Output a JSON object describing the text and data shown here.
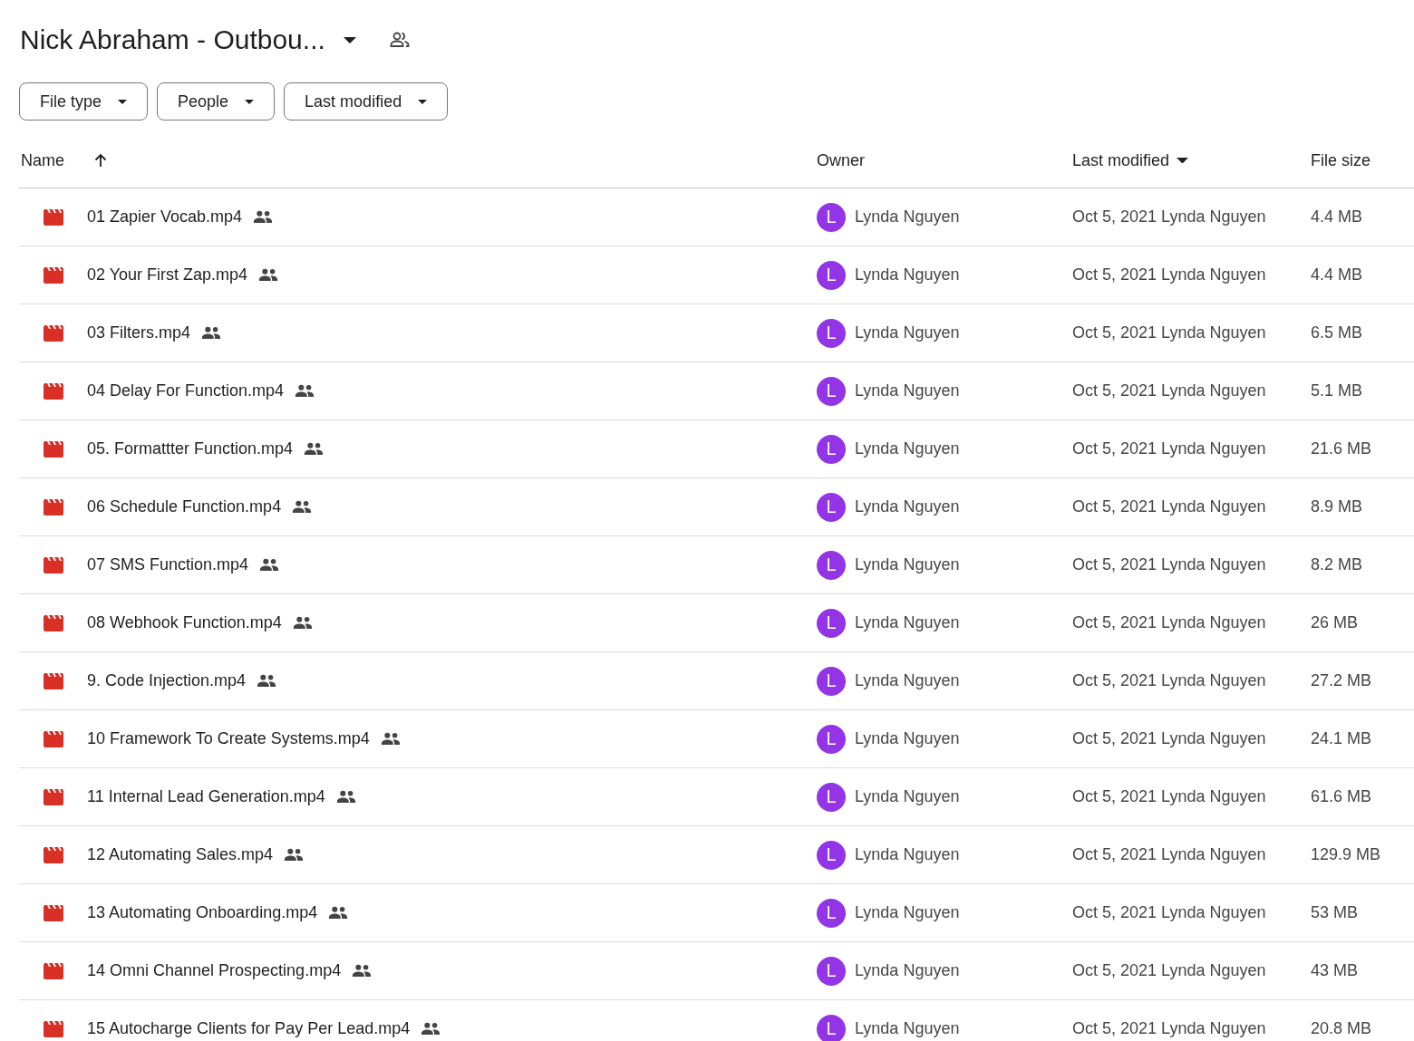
{
  "title": "Nick Abraham - Outbou...",
  "filters": [
    "File type",
    "People",
    "Last modified"
  ],
  "columns": {
    "name": "Name",
    "owner": "Owner",
    "modified": "Last modified",
    "size": "File size"
  },
  "rows": [
    {
      "name": "01 Zapier Vocab.mp4",
      "owner_initial": "L",
      "owner": "Lynda Nguyen",
      "modified": "Oct 5, 2021 Lynda Nguyen",
      "size": "4.4 MB"
    },
    {
      "name": "02 Your First Zap.mp4",
      "owner_initial": "L",
      "owner": "Lynda Nguyen",
      "modified": "Oct 5, 2021 Lynda Nguyen",
      "size": "4.4 MB"
    },
    {
      "name": "03 Filters.mp4",
      "owner_initial": "L",
      "owner": "Lynda Nguyen",
      "modified": "Oct 5, 2021 Lynda Nguyen",
      "size": "6.5 MB"
    },
    {
      "name": "04 Delay For Function.mp4",
      "owner_initial": "L",
      "owner": "Lynda Nguyen",
      "modified": "Oct 5, 2021 Lynda Nguyen",
      "size": "5.1 MB"
    },
    {
      "name": "05. Formattter Function.mp4",
      "owner_initial": "L",
      "owner": "Lynda Nguyen",
      "modified": "Oct 5, 2021 Lynda Nguyen",
      "size": "21.6 MB"
    },
    {
      "name": "06 Schedule Function.mp4",
      "owner_initial": "L",
      "owner": "Lynda Nguyen",
      "modified": "Oct 5, 2021 Lynda Nguyen",
      "size": "8.9 MB"
    },
    {
      "name": "07 SMS Function.mp4",
      "owner_initial": "L",
      "owner": "Lynda Nguyen",
      "modified": "Oct 5, 2021 Lynda Nguyen",
      "size": "8.2 MB"
    },
    {
      "name": "08 Webhook Function.mp4",
      "owner_initial": "L",
      "owner": "Lynda Nguyen",
      "modified": "Oct 5, 2021 Lynda Nguyen",
      "size": "26 MB"
    },
    {
      "name": "9. Code Injection.mp4",
      "owner_initial": "L",
      "owner": "Lynda Nguyen",
      "modified": "Oct 5, 2021 Lynda Nguyen",
      "size": "27.2 MB"
    },
    {
      "name": "10 Framework To Create Systems.mp4",
      "owner_initial": "L",
      "owner": "Lynda Nguyen",
      "modified": "Oct 5, 2021 Lynda Nguyen",
      "size": "24.1 MB"
    },
    {
      "name": "11 Internal Lead Generation.mp4",
      "owner_initial": "L",
      "owner": "Lynda Nguyen",
      "modified": "Oct 5, 2021 Lynda Nguyen",
      "size": "61.6 MB"
    },
    {
      "name": "12 Automating Sales.mp4",
      "owner_initial": "L",
      "owner": "Lynda Nguyen",
      "modified": "Oct 5, 2021 Lynda Nguyen",
      "size": "129.9 MB"
    },
    {
      "name": "13 Automating Onboarding.mp4",
      "owner_initial": "L",
      "owner": "Lynda Nguyen",
      "modified": "Oct 5, 2021 Lynda Nguyen",
      "size": "53 MB"
    },
    {
      "name": "14 Omni Channel Prospecting.mp4",
      "owner_initial": "L",
      "owner": "Lynda Nguyen",
      "modified": "Oct 5, 2021 Lynda Nguyen",
      "size": "43 MB"
    },
    {
      "name": "15 Autocharge Clients for Pay Per Lead.mp4",
      "owner_initial": "L",
      "owner": "Lynda Nguyen",
      "modified": "Oct 5, 2021 Lynda Nguyen",
      "size": "20.8 MB"
    }
  ]
}
